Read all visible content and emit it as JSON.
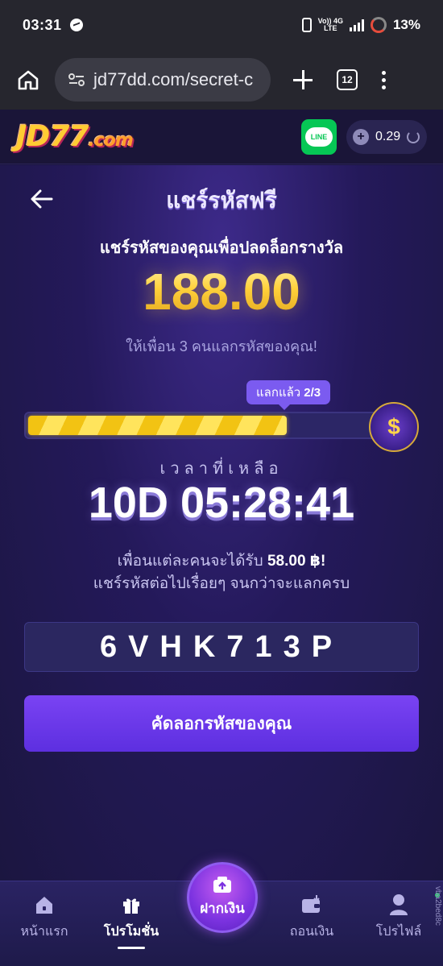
{
  "status_bar": {
    "time": "03:31",
    "lte_top": "Vo)) 4G",
    "lte_bottom": "LTE",
    "battery": "13%"
  },
  "browser": {
    "url": "jd77dd.com/secret-c",
    "tab_count": "12"
  },
  "header": {
    "logo_main": "JD77",
    "logo_suffix": ".com",
    "line_label": "LINE",
    "balance": "0.29"
  },
  "page": {
    "title": "แชร์รหัสฟรี",
    "subtitle": "แชร์รหัสของคุณเพื่อปลดล็อกรางวัล",
    "amount": "188.00",
    "invite_text": "ให้เพื่อน 3 คนแลกรหัสของคุณ!",
    "progress_label": "แลกแล้ว",
    "progress_value": "2/3",
    "progress_fraction": 0.667,
    "time_label": "เวลาที่เหลือ",
    "countdown": "10D 05:28:41",
    "info_prefix": "เพื่อนแต่ละคนจะได้รับ",
    "info_amount": "58.00 ฿!",
    "info_line2": "แชร์รหัสต่อไปเรื่อยๆ จนกว่าจะแลกครบ",
    "code": "6VHK713P",
    "copy_button": "คัดลอกรหัสของคุณ"
  },
  "bottom_nav": {
    "home": "หน้าแรก",
    "promo": "โปรโมชั่น",
    "deposit": "ฝากเงิน",
    "withdraw": "ถอนเงิน",
    "profile": "โปรไฟล์"
  },
  "side_tag": "vba2bed8c",
  "colors": {
    "accent": "#6a38ea",
    "gold": "#ffd13b",
    "background": "#1b1640"
  }
}
